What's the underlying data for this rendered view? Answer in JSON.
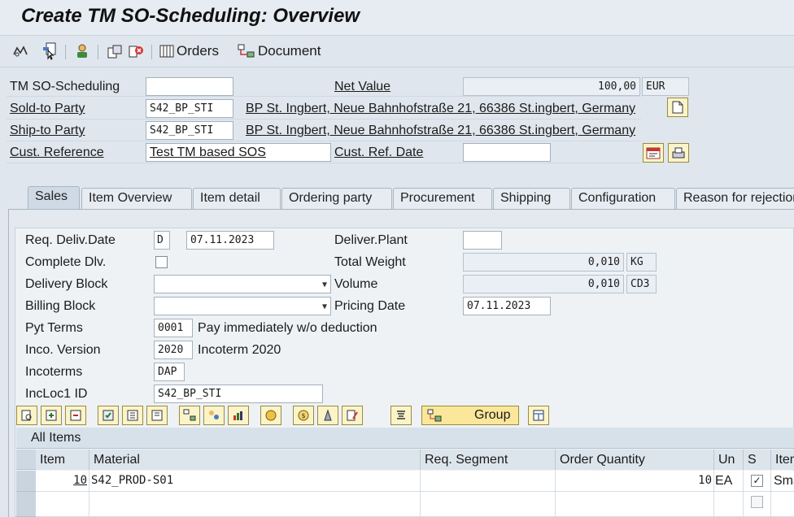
{
  "window": {
    "title": "Create TM SO-Scheduling: Overview"
  },
  "toolbar": {
    "orders_label": "Orders",
    "document_label": "Document"
  },
  "header": {
    "so_scheduling": {
      "label": "TM SO-Scheduling",
      "value": ""
    },
    "net_value": {
      "label": "Net Value",
      "value": "100,00",
      "currency": "EUR"
    },
    "sold_to": {
      "label": "Sold-to Party",
      "value": "S42_BP_STI",
      "address": "BP St. Ingbert, Neue Bahnhofstraße 21, 66386 St.ingbert, Germany"
    },
    "ship_to": {
      "label": "Ship-to Party",
      "value": "S42_BP_STI",
      "address": "BP St. Ingbert, Neue Bahnhofstraße 21, 66386 St.ingbert, Germany"
    },
    "cust_ref": {
      "label": "Cust. Reference",
      "value": "Test TM based SOS"
    },
    "cust_ref_date": {
      "label": "Cust. Ref. Date",
      "value": ""
    }
  },
  "tabs": [
    "Sales",
    "Item Overview",
    "Item detail",
    "Ordering party",
    "Procurement",
    "Shipping",
    "Configuration",
    "Reason for rejection"
  ],
  "sales": {
    "req_deliv_date": {
      "label": "Req. Deliv.Date",
      "unit": "D",
      "value": "07.11.2023"
    },
    "complete_dlv": {
      "label": "Complete Dlv."
    },
    "delivery_block": {
      "label": "Delivery Block",
      "value": ""
    },
    "billing_block": {
      "label": "Billing Block",
      "value": ""
    },
    "pyt_terms": {
      "label": "Pyt Terms",
      "code": "0001",
      "text": "Pay immediately w/o deduction"
    },
    "inco_version": {
      "label": "Inco. Version",
      "code": "2020",
      "text": "Incoterm 2020"
    },
    "incoterms": {
      "label": "Incoterms",
      "value": "DAP"
    },
    "incloc1": {
      "label": "IncLoc1 ID",
      "value": "S42_BP_STI"
    },
    "deliver_plant": {
      "label": "Deliver.Plant",
      "value": ""
    },
    "total_weight": {
      "label": "Total Weight",
      "value": "0,010",
      "unit": "KG"
    },
    "volume": {
      "label": "Volume",
      "value": "0,010",
      "unit": "CD3"
    },
    "pricing_date": {
      "label": "Pricing Date",
      "value": "07.11.2023"
    }
  },
  "items_toolbar": {
    "group_label": "Group"
  },
  "items": {
    "title": "All Items",
    "columns": [
      "Item",
      "Material",
      "Req. Segment",
      "Order Quantity",
      "Un",
      "S",
      "Item Description"
    ],
    "rows": [
      {
        "item": "10",
        "material": "S42_PROD-S01",
        "segment": "",
        "qty": "10",
        "unit": "EA",
        "s": "✓",
        "desc": "Smartphone"
      },
      {
        "item": "",
        "material": "",
        "segment": "",
        "qty": "",
        "unit": "",
        "s": "",
        "desc": ""
      }
    ]
  }
}
